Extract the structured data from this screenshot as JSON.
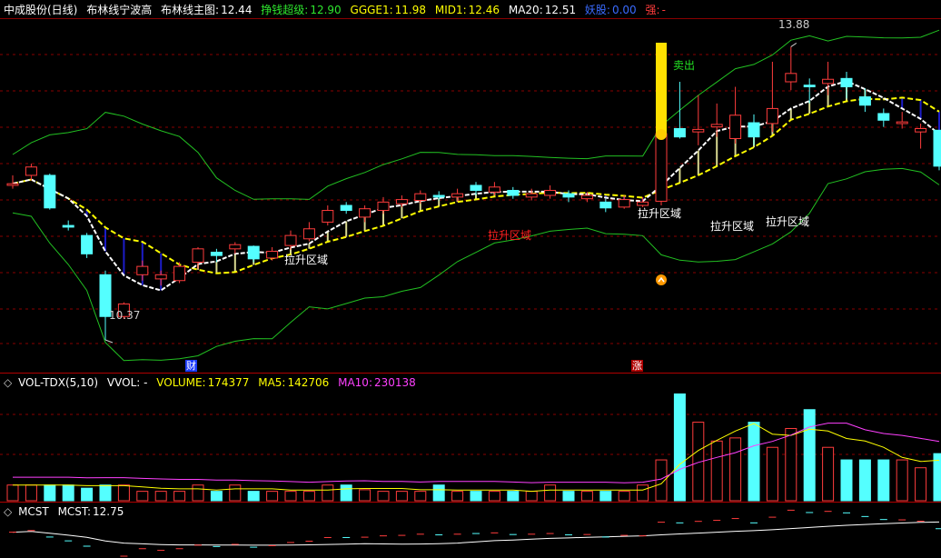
{
  "main_header": {
    "stock": "中成股份(日线)",
    "indicator": "布林线宁波高",
    "main_label": "布林线主图:",
    "main_value": "12.44",
    "earn_label": "挣钱超级:",
    "earn_value": "12.90",
    "ggge_label": "GGGE1:",
    "ggge_value": "11.98",
    "mid_label": "MID1:",
    "mid_value": "12.46",
    "ma20_label": "MA20:",
    "ma20_value": "12.51",
    "demon_label": "妖股:",
    "demon_value": "0.00",
    "strong_label": "强:",
    "strong_value": "-"
  },
  "vol_header": {
    "name": "VOL-TDX(5,10)",
    "vvol": "VVOL: -",
    "volume_label": "VOLUME:",
    "volume_value": "174377",
    "ma5_label": "MA5:",
    "ma5_value": "142706",
    "ma10_label": "MA10:",
    "ma10_value": "230138"
  },
  "mcst_header": {
    "name": "MCST",
    "label": "MCST:",
    "value": "12.75"
  },
  "annotations": {
    "high": "13.88",
    "low": "10.37",
    "sell": "卖出",
    "lift_zone_1": "拉升区域",
    "lift_zone_2": "拉升区域",
    "lift_zone_3": "拉升区域",
    "lift_zone_4": "拉升区域",
    "red_zone": "拉升区域",
    "marker_cai": "财",
    "marker_zhang": "涨"
  },
  "colors": {
    "up": "#ff3c3c",
    "down": "#54ffff",
    "grid": "#8a0000",
    "ma_yellow": "#ffff00",
    "ma_magenta": "#ff40ff",
    "boll_green": "#22c022"
  },
  "chart_data": {
    "type": "candlestick",
    "candles": [
      [
        12.22,
        12.24,
        12.34,
        12.18,
        1
      ],
      [
        12.44,
        12.34,
        12.48,
        12.28,
        1
      ],
      [
        12.34,
        11.95,
        12.36,
        11.93,
        0
      ],
      [
        11.74,
        11.72,
        11.8,
        11.68,
        0
      ],
      [
        11.62,
        11.4,
        11.65,
        11.35,
        0
      ],
      [
        11.15,
        10.65,
        11.2,
        10.37,
        0
      ],
      [
        10.65,
        10.8,
        10.82,
        10.62,
        1
      ],
      [
        11.15,
        11.25,
        11.32,
        11.08,
        1
      ],
      [
        11.1,
        11.15,
        11.2,
        11.02,
        1
      ],
      [
        11.08,
        11.25,
        11.3,
        11.05,
        1
      ],
      [
        11.3,
        11.46,
        11.48,
        11.22,
        1
      ],
      [
        11.42,
        11.38,
        11.46,
        11.3,
        0
      ],
      [
        11.46,
        11.51,
        11.54,
        11.4,
        1
      ],
      [
        11.49,
        11.34,
        11.5,
        11.3,
        0
      ],
      [
        11.35,
        11.43,
        11.48,
        11.32,
        1
      ],
      [
        11.5,
        11.62,
        11.68,
        11.45,
        1
      ],
      [
        11.58,
        11.7,
        11.78,
        11.55,
        1
      ],
      [
        11.78,
        11.92,
        11.98,
        11.74,
        1
      ],
      [
        11.98,
        11.92,
        12.02,
        11.88,
        0
      ],
      [
        11.84,
        11.94,
        11.98,
        11.78,
        1
      ],
      [
        11.92,
        12.02,
        12.08,
        11.88,
        1
      ],
      [
        12.0,
        12.05,
        12.1,
        11.96,
        1
      ],
      [
        12.04,
        12.12,
        12.16,
        12.0,
        1
      ],
      [
        12.1,
        12.08,
        12.15,
        12.04,
        0
      ],
      [
        12.08,
        12.12,
        12.18,
        12.03,
        1
      ],
      [
        12.22,
        12.16,
        12.26,
        12.1,
        0
      ],
      [
        12.14,
        12.2,
        12.26,
        12.1,
        1
      ],
      [
        12.16,
        12.1,
        12.2,
        12.06,
        0
      ],
      [
        12.08,
        12.12,
        12.18,
        12.04,
        1
      ],
      [
        12.1,
        12.16,
        12.22,
        12.06,
        1
      ],
      [
        12.12,
        12.08,
        12.16,
        12.02,
        0
      ],
      [
        12.06,
        12.1,
        12.14,
        12.02,
        1
      ],
      [
        12.02,
        11.95,
        12.06,
        11.9,
        0
      ],
      [
        11.96,
        12.05,
        12.1,
        11.94,
        1
      ],
      [
        11.98,
        12.02,
        12.08,
        11.96,
        1
      ],
      [
        12.03,
        12.84,
        12.84,
        11.98,
        1
      ],
      [
        12.9,
        12.8,
        13.46,
        12.78,
        0
      ],
      [
        12.86,
        12.89,
        13.3,
        12.7,
        1
      ],
      [
        12.92,
        12.95,
        13.2,
        12.8,
        1
      ],
      [
        12.78,
        13.06,
        13.4,
        12.72,
        1
      ],
      [
        12.97,
        12.8,
        13.07,
        12.7,
        0
      ],
      [
        12.96,
        13.14,
        13.7,
        12.86,
        1
      ],
      [
        13.46,
        13.56,
        13.88,
        13.36,
        1
      ],
      [
        13.4,
        13.42,
        13.5,
        13.2,
        0
      ],
      [
        13.44,
        13.49,
        13.7,
        13.3,
        1
      ],
      [
        13.5,
        13.4,
        13.58,
        13.26,
        0
      ],
      [
        13.28,
        13.18,
        13.38,
        13.1,
        0
      ],
      [
        13.08,
        13.0,
        13.14,
        12.92,
        0
      ],
      [
        12.96,
        12.98,
        13.1,
        12.9,
        1
      ],
      [
        12.86,
        12.9,
        12.96,
        12.66,
        1
      ],
      [
        12.88,
        12.45,
        12.88,
        12.4,
        0
      ]
    ],
    "volume": [
      1,
      1,
      1,
      1,
      0.8,
      1,
      1,
      0.6,
      0.6,
      0.6,
      1,
      0.6,
      1,
      0.6,
      0.6,
      0.6,
      0.6,
      1,
      1,
      0.7,
      0.6,
      0.6,
      0.6,
      1,
      0.6,
      0.6,
      0.6,
      0.6,
      0.6,
      1,
      0.6,
      0.6,
      0.6,
      0.6,
      1,
      2.6,
      6.8,
      5.0,
      3.8,
      4.0,
      5.0,
      3.4,
      4.6,
      5.8,
      3.4,
      2.6,
      2.6,
      2.6,
      2.6,
      2.1,
      3.0
    ],
    "ylim": [
      10.0,
      14.2
    ]
  }
}
